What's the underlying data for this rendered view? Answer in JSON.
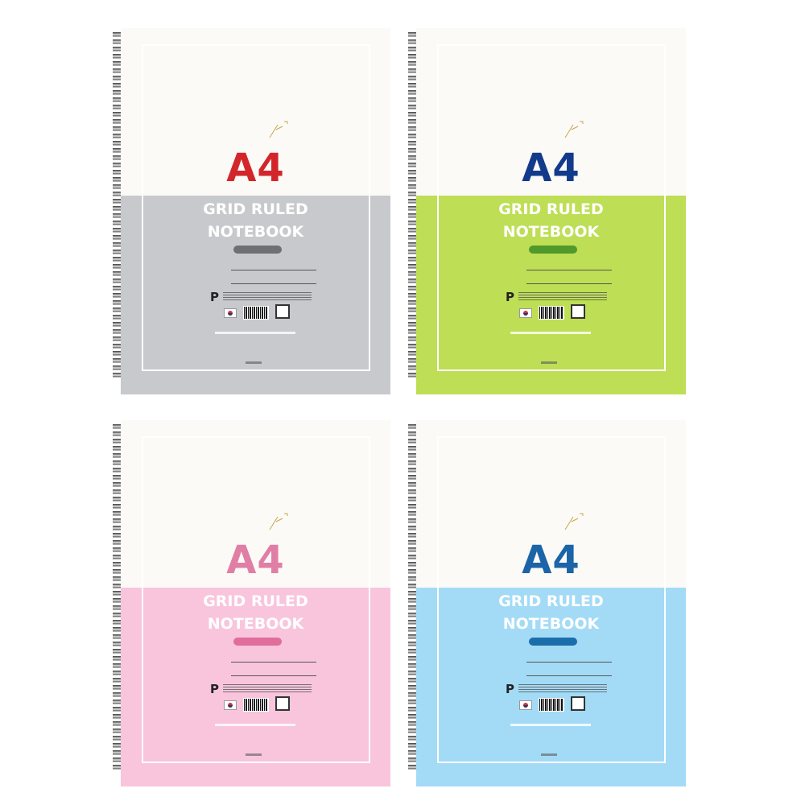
{
  "notebooks": [
    {
      "id": "gray",
      "size_label": "A4",
      "title_line1": "GRID RULED",
      "title_line2": "NOTEBOOK",
      "accent": "#c8c9cc",
      "size_color": "#d3262b",
      "pill_color": "#6f7074",
      "frame_color": "#d9d9d9"
    },
    {
      "id": "green",
      "size_label": "A4",
      "title_line1": "GRID RULED",
      "title_line2": "NOTEBOOK",
      "accent": "#bede55",
      "size_color": "#123b8c",
      "pill_color": "#4f9a2a",
      "frame_color": "#e0e19a"
    },
    {
      "id": "pink",
      "size_label": "A4",
      "title_line1": "GRID RULED",
      "title_line2": "NOTEBOOK",
      "accent": "#f8c5dd",
      "size_color": "#e07ea6",
      "pill_color": "#e06d9c",
      "frame_color": "#f3c9d4"
    },
    {
      "id": "blue",
      "size_label": "A4",
      "title_line1": "GRID RULED",
      "title_line2": "NOTEBOOK",
      "accent": "#a3dbf7",
      "size_color": "#1b64a8",
      "pill_color": "#1c6eaa",
      "frame_color": "#bfe2f4"
    }
  ]
}
